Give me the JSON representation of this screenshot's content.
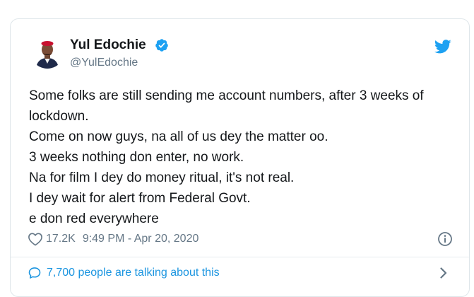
{
  "tweet": {
    "display_name": "Yul Edochie",
    "handle": "@YulEdochie",
    "text_lines": [
      "Some folks are still sending me account numbers, after 3 weeks of",
      "lockdown.",
      "Come on now guys, na all of us dey the matter oo.",
      "3 weeks nothing don enter, no work.",
      "Na for film I dey do money ritual, it's not real.",
      "I dey wait for alert from Federal Govt.",
      "e don red everywhere"
    ],
    "likes": "17.2K",
    "timestamp": "9:49 PM - Apr 20, 2020",
    "conversation_label": "7,700 people are talking about this"
  },
  "icons": {
    "verified": "verified-badge-icon",
    "brand": "twitter-bird-icon",
    "like": "heart-outline-icon",
    "info": "info-circle-icon",
    "comment": "speech-bubble-icon",
    "chevron": "chevron-right-icon"
  },
  "colors": {
    "brand_blue": "#1da1f2",
    "link_blue": "#1b95e0",
    "text_primary": "#14171a",
    "text_secondary": "#657786",
    "border": "#dfe6ea"
  }
}
